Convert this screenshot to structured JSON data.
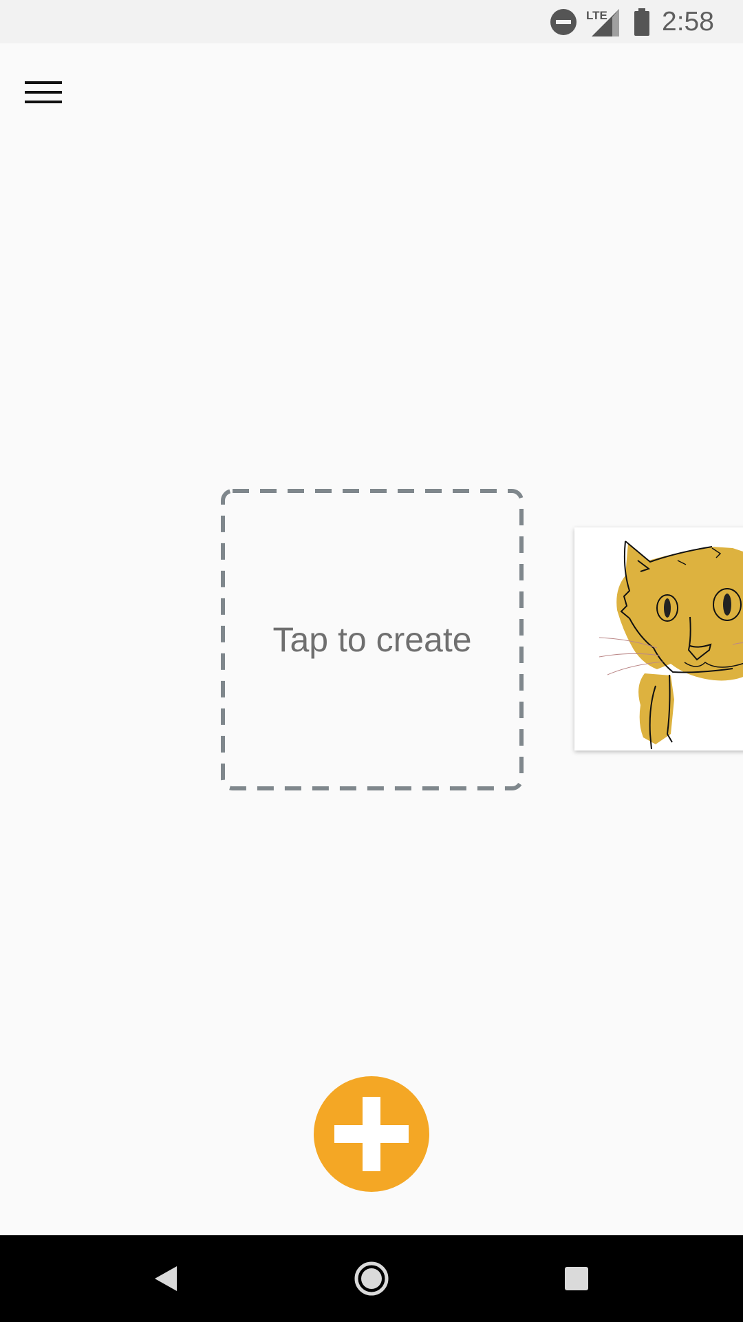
{
  "status_bar": {
    "time": "2:58",
    "network_label": "LTE",
    "icons": [
      "do-not-disturb-icon",
      "lte-signal-icon",
      "battery-icon"
    ]
  },
  "toolbar": {
    "menu_icon": "hamburger-menu-icon"
  },
  "canvas": {
    "create_tile_label": "Tap to create",
    "drawing_card": "cat-drawing-thumbnail"
  },
  "fab": {
    "icon": "plus-icon",
    "color": "#f4a725"
  },
  "nav_bar": {
    "icons": [
      "back-icon",
      "home-icon",
      "recents-icon"
    ]
  },
  "colors": {
    "accent": "#f4a725",
    "cat_fill": "#ddb23f",
    "dash_border": "#7f878c",
    "text_secondary": "#6f6f6f"
  }
}
